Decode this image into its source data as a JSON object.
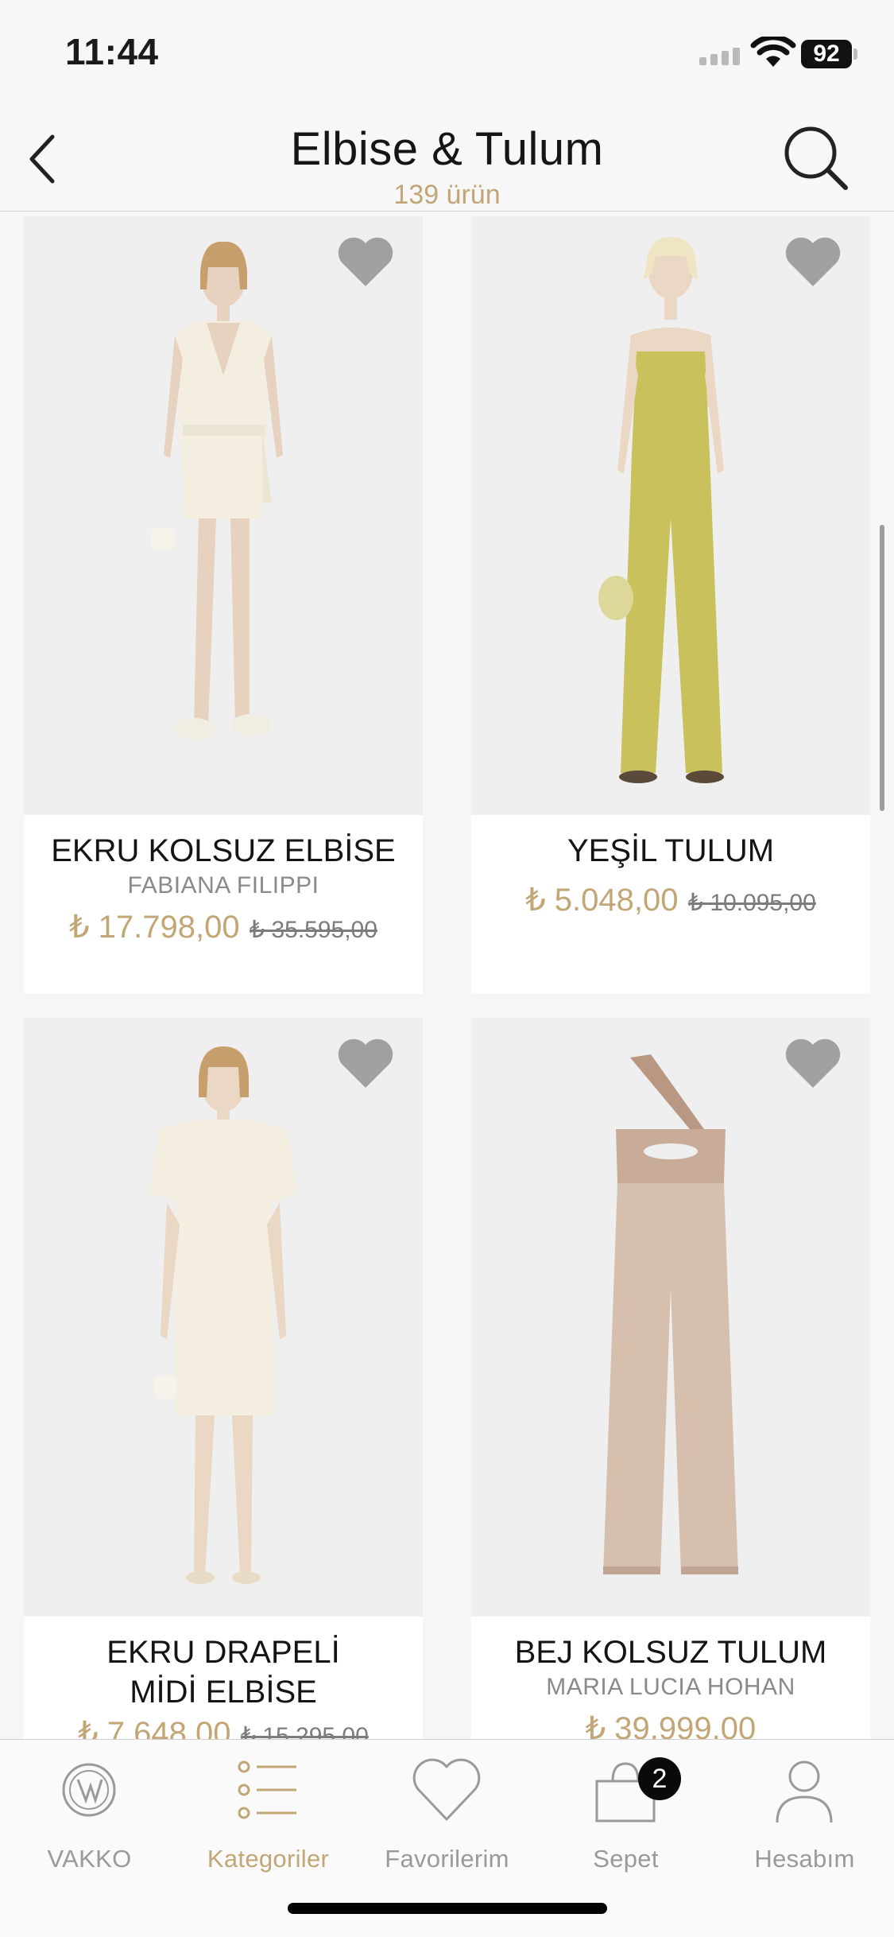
{
  "status": {
    "time": "11:44",
    "battery": "92"
  },
  "header": {
    "title": "Elbise & Tulum",
    "count": "139 ürün"
  },
  "products": [
    {
      "name": "EKRU KOLSUZ ELBİSE",
      "brand": "FABIANA FILIPPI",
      "price": "₺ 17.798,00",
      "old_price": "₺ 35.595,00"
    },
    {
      "name": "YEŞİL TULUM",
      "brand": "",
      "price": "₺ 5.048,00",
      "old_price": "₺ 10.095,00"
    },
    {
      "name": "EKRU DRAPELİ\nMİDİ ELBİSE",
      "brand": "",
      "price": "₺ 7.648,00",
      "old_price": "₺ 15.295,00"
    },
    {
      "name": "BEJ KOLSUZ TULUM",
      "brand": "MARIA LUCIA HOHAN",
      "price": "₺ 39.999,00",
      "old_price": ""
    }
  ],
  "tabs": [
    {
      "label": "VAKKO",
      "icon": "vakko-logo-icon"
    },
    {
      "label": "Kategoriler",
      "icon": "list-icon",
      "active": true
    },
    {
      "label": "Favorilerim",
      "icon": "heart-icon"
    },
    {
      "label": "Sepet",
      "icon": "bag-icon",
      "badge": "2"
    },
    {
      "label": "Hesabım",
      "icon": "person-icon"
    }
  ],
  "colors": {
    "accent": "#c2a676",
    "muted": "#9a9a9a",
    "heart": "#a0a0a0"
  }
}
